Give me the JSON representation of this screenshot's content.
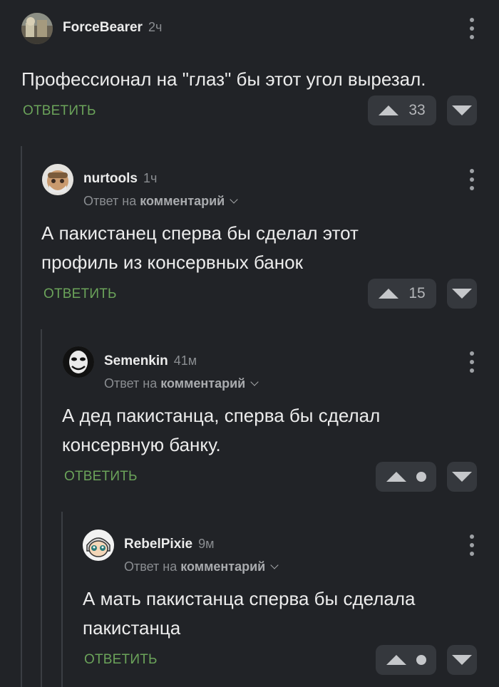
{
  "comments": [
    {
      "author": "ForceBearer",
      "time": "2ч",
      "text_lines": [
        "Профессионал на \"глаз\" бы этот угол вырезал."
      ],
      "reply_label": "ОТВЕТИТЬ",
      "votes": "33"
    },
    {
      "author": "nurtools",
      "time": "1ч",
      "reply_to_prefix": "Ответ на",
      "reply_to_link": "комментарий",
      "text_lines": [
        "А пакистанец сперва бы сделал этот",
        "профиль из консервных банок"
      ],
      "reply_label": "ОТВЕТИТЬ",
      "votes": "15"
    },
    {
      "author": "Semenkin",
      "time": "41м",
      "reply_to_prefix": "Ответ на",
      "reply_to_link": "комментарий",
      "text_lines": [
        "А дед пакистанца, сперва бы сделал",
        "консервную банку."
      ],
      "reply_label": "ОТВЕТИТЬ"
    },
    {
      "author": "RebelPixie",
      "time": "9м",
      "reply_to_prefix": "Ответ на",
      "reply_to_link": "комментарий",
      "text_lines": [
        "А мать пакистанца сперва бы сделала",
        "пакистанца"
      ],
      "reply_label": "ОТВЕТИТЬ"
    }
  ],
  "icons": {
    "menu": "more-vertical-icon",
    "upvote": "upvote-triangle-icon",
    "downvote": "downvote-triangle-icon",
    "chevron": "chevron-down-icon"
  },
  "colors": {
    "background": "#212327",
    "reply_green": "#6ba35a",
    "vote_bg": "#35383d"
  }
}
